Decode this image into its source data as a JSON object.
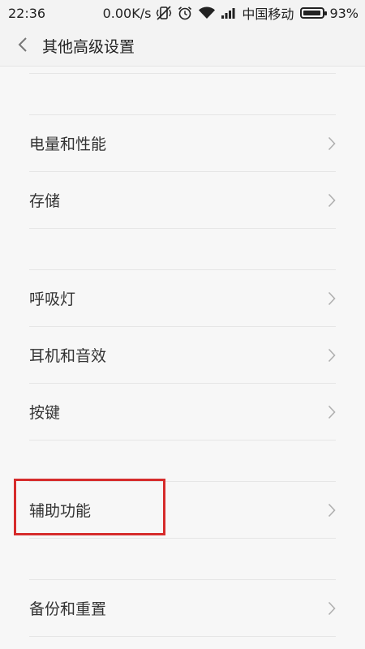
{
  "status_bar": {
    "time": "22:36",
    "net_speed": "0.00K/s",
    "carrier": "中国移动",
    "battery_percent": "93%",
    "battery_level": 0.93,
    "icons": [
      "vibrate-off-icon",
      "alarm-icon",
      "wifi-icon",
      "signal-icon",
      "battery-icon"
    ]
  },
  "header": {
    "title": "其他高级设置",
    "back_icon": "chevron-left-icon"
  },
  "groups": [
    {
      "items": [
        {
          "label": "电量和性能"
        },
        {
          "label": "存储"
        }
      ]
    },
    {
      "items": [
        {
          "label": "呼吸灯"
        },
        {
          "label": "耳机和音效"
        },
        {
          "label": "按键"
        }
      ]
    },
    {
      "items": [
        {
          "label": "辅助功能",
          "highlighted": true
        }
      ]
    },
    {
      "items": [
        {
          "label": "备份和重置"
        }
      ]
    }
  ],
  "colors": {
    "background": "#f7f7f7",
    "divider": "#e6e6e6",
    "highlight_border": "#d62c2c",
    "chevron": "#b0b0b0"
  }
}
